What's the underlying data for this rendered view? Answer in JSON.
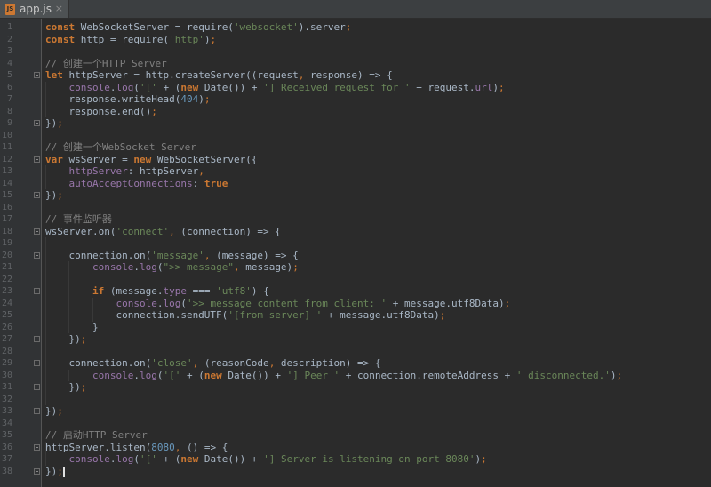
{
  "tab": {
    "label": "app.js",
    "icon": "js-file-icon"
  },
  "colors": {
    "background": "#2b2b2b",
    "gutter": "#313335",
    "keyword": "#cc7832",
    "string": "#6a8759",
    "number": "#6897bb",
    "comment": "#808080",
    "field": "#9876aa",
    "default": "#a9b7c6"
  },
  "lines": [
    [
      [
        "k",
        "const"
      ],
      [
        "t",
        " WebSocketServer = require("
      ],
      [
        "s",
        "'websocket'"
      ],
      [
        "t",
        ").server"
      ],
      [
        "p",
        ";"
      ]
    ],
    [
      [
        "k",
        "const"
      ],
      [
        "t",
        " http = require("
      ],
      [
        "s",
        "'http'"
      ],
      [
        "t",
        ")"
      ],
      [
        "p",
        ";"
      ]
    ],
    [],
    [
      [
        "c",
        "// 创建一个HTTP Server"
      ]
    ],
    [
      [
        "k",
        "let"
      ],
      [
        "t",
        " httpServer = http.createServer((request"
      ],
      [
        "p",
        ","
      ],
      [
        "t",
        " response) => {"
      ]
    ],
    [
      [
        "t",
        "    "
      ],
      [
        "f",
        "console"
      ],
      [
        "t",
        "."
      ],
      [
        "f",
        "log"
      ],
      [
        "t",
        "("
      ],
      [
        "s",
        "'['"
      ],
      [
        "t",
        " + ("
      ],
      [
        "k",
        "new"
      ],
      [
        "t",
        " Date()) + "
      ],
      [
        "s",
        "'] Received request for '"
      ],
      [
        "t",
        " + request."
      ],
      [
        "f",
        "url"
      ],
      [
        "t",
        ")"
      ],
      [
        "p",
        ";"
      ]
    ],
    [
      [
        "t",
        "    response.writeHead("
      ],
      [
        "n",
        "404"
      ],
      [
        "t",
        ")"
      ],
      [
        "p",
        ";"
      ]
    ],
    [
      [
        "t",
        "    response.end()"
      ],
      [
        "p",
        ";"
      ]
    ],
    [
      [
        "t",
        "})"
      ],
      [
        "p",
        ";"
      ]
    ],
    [],
    [
      [
        "c",
        "// 创建一个WebSocket Server"
      ]
    ],
    [
      [
        "k",
        "var"
      ],
      [
        "t",
        " wsServer = "
      ],
      [
        "k",
        "new"
      ],
      [
        "t",
        " WebSocketServer({"
      ]
    ],
    [
      [
        "t",
        "    "
      ],
      [
        "f",
        "httpServer"
      ],
      [
        "t",
        ": httpServer"
      ],
      [
        "p",
        ","
      ]
    ],
    [
      [
        "t",
        "    "
      ],
      [
        "f",
        "autoAcceptConnections"
      ],
      [
        "t",
        ": "
      ],
      [
        "k",
        "true"
      ]
    ],
    [
      [
        "t",
        "})"
      ],
      [
        "p",
        ";"
      ]
    ],
    [],
    [
      [
        "c",
        "// 事件监听器"
      ]
    ],
    [
      [
        "t",
        "wsServer.on("
      ],
      [
        "s",
        "'connect'"
      ],
      [
        "p",
        ","
      ],
      [
        "t",
        " (connection) => {"
      ]
    ],
    [],
    [
      [
        "t",
        "    connection.on("
      ],
      [
        "s",
        "'message'"
      ],
      [
        "p",
        ","
      ],
      [
        "t",
        " (message) => {"
      ]
    ],
    [
      [
        "t",
        "        "
      ],
      [
        "f",
        "console"
      ],
      [
        "t",
        "."
      ],
      [
        "f",
        "log"
      ],
      [
        "t",
        "("
      ],
      [
        "s",
        "\">> message\""
      ],
      [
        "p",
        ","
      ],
      [
        "t",
        " message)"
      ],
      [
        "p",
        ";"
      ]
    ],
    [],
    [
      [
        "t",
        "        "
      ],
      [
        "k",
        "if"
      ],
      [
        "t",
        " (message."
      ],
      [
        "f",
        "type"
      ],
      [
        "t",
        " === "
      ],
      [
        "s",
        "'utf8'"
      ],
      [
        "t",
        ") {"
      ]
    ],
    [
      [
        "t",
        "            "
      ],
      [
        "f",
        "console"
      ],
      [
        "t",
        "."
      ],
      [
        "f",
        "log"
      ],
      [
        "t",
        "("
      ],
      [
        "s",
        "'>> message content from client: '"
      ],
      [
        "t",
        " + message.utf8Data)"
      ],
      [
        "p",
        ";"
      ]
    ],
    [
      [
        "t",
        "            connection.sendUTF("
      ],
      [
        "s",
        "'[from server] '"
      ],
      [
        "t",
        " + message.utf8Data)"
      ],
      [
        "p",
        ";"
      ]
    ],
    [
      [
        "t",
        "        }"
      ]
    ],
    [
      [
        "t",
        "    })"
      ],
      [
        "p",
        ";"
      ]
    ],
    [],
    [
      [
        "t",
        "    connection.on("
      ],
      [
        "s",
        "'close'"
      ],
      [
        "p",
        ","
      ],
      [
        "t",
        " (reasonCode"
      ],
      [
        "p",
        ","
      ],
      [
        "t",
        " description) => {"
      ]
    ],
    [
      [
        "t",
        "        "
      ],
      [
        "f",
        "console"
      ],
      [
        "t",
        "."
      ],
      [
        "f",
        "log"
      ],
      [
        "t",
        "("
      ],
      [
        "s",
        "'['"
      ],
      [
        "t",
        " + ("
      ],
      [
        "k",
        "new"
      ],
      [
        "t",
        " Date()) + "
      ],
      [
        "s",
        "'] Peer '"
      ],
      [
        "t",
        " + connection.remoteAddress + "
      ],
      [
        "s",
        "' disconnected.'"
      ],
      [
        "t",
        ")"
      ],
      [
        "p",
        ";"
      ]
    ],
    [
      [
        "t",
        "    })"
      ],
      [
        "p",
        ";"
      ]
    ],
    [],
    [
      [
        "t",
        "})"
      ],
      [
        "p",
        ";"
      ]
    ],
    [],
    [
      [
        "c",
        "// 启动HTTP Server"
      ]
    ],
    [
      [
        "t",
        "httpServer.listen("
      ],
      [
        "n",
        "8080"
      ],
      [
        "p",
        ","
      ],
      [
        "t",
        " () => {"
      ]
    ],
    [
      [
        "t",
        "    "
      ],
      [
        "f",
        "console"
      ],
      [
        "t",
        "."
      ],
      [
        "f",
        "log"
      ],
      [
        "t",
        "("
      ],
      [
        "s",
        "'['"
      ],
      [
        "t",
        " + ("
      ],
      [
        "k",
        "new"
      ],
      [
        "t",
        " Date()) + "
      ],
      [
        "s",
        "'] Server is listening on port 8080'"
      ],
      [
        "t",
        ")"
      ],
      [
        "p",
        ";"
      ]
    ],
    [
      [
        "t",
        "})"
      ],
      [
        "p",
        ";"
      ]
    ]
  ],
  "fold_lines": [
    5,
    9,
    12,
    15,
    18,
    20,
    23,
    27,
    29,
    31,
    33,
    36,
    38
  ],
  "caret_line": 38
}
